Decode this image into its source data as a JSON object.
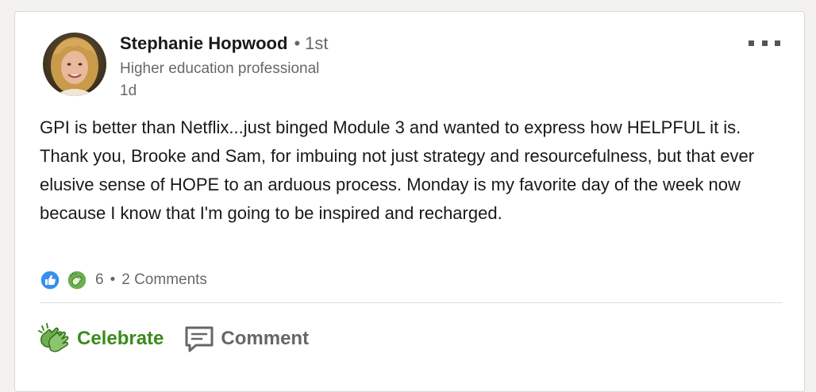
{
  "post": {
    "author_name": "Stephanie Hopwood",
    "connection_degree": "1st",
    "headline": "Higher education professional",
    "timestamp": "1d",
    "body": "GPI is better than Netflix...just binged Module 3 and wanted to express how HELPFUL it is. Thank you, Brooke and Sam, for imbuing not just strategy and resourcefulness, but that ever elusive sense of HOPE to an arduous process. Monday is my favorite day of the week now because I know that I'm going to be inspired and recharged."
  },
  "social": {
    "reaction_icons": [
      "like-icon",
      "celebrate-icon"
    ],
    "reaction_count": "6",
    "separator": "•",
    "comments_label": "2 Comments"
  },
  "actions": {
    "celebrate_label": "Celebrate",
    "comment_label": "Comment"
  },
  "colors": {
    "like_blue": "#378fe9",
    "celebrate_green": "#3b8b1c",
    "text_secondary": "#666666"
  }
}
